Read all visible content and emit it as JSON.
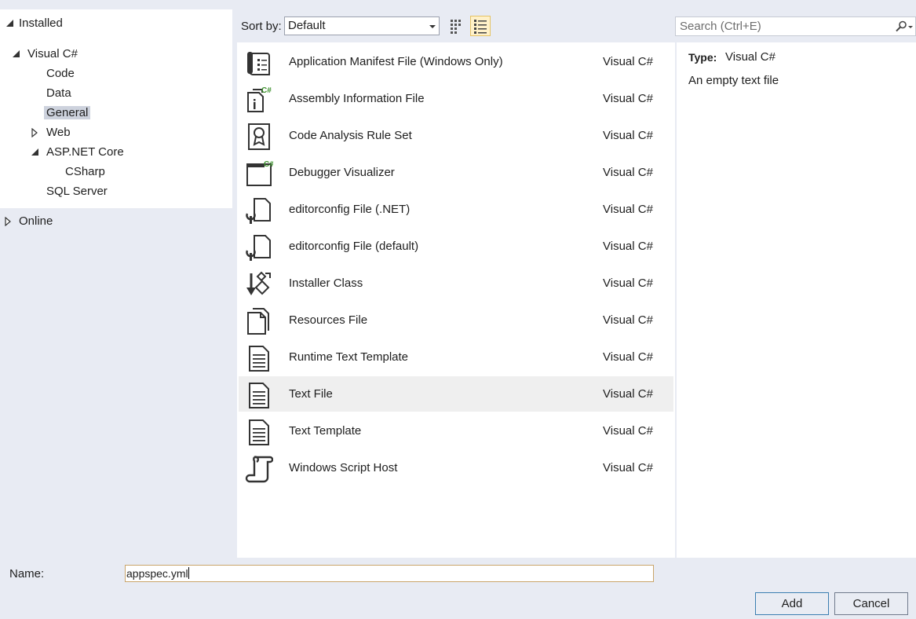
{
  "tree": {
    "installed": "Installed",
    "visual_csharp": "Visual C#",
    "code": "Code",
    "data": "Data",
    "general": "General",
    "web": "Web",
    "aspnet_core": "ASP.NET Core",
    "csharp": "CSharp",
    "sql_server": "SQL Server",
    "online": "Online"
  },
  "toolbar": {
    "sort_label": "Sort by:",
    "sort_value": "Default",
    "search_placeholder": "Search (Ctrl+E)"
  },
  "templates": [
    {
      "name": "Application Manifest File (Windows Only)",
      "lang": "Visual C#",
      "icon": "manifest-icon"
    },
    {
      "name": "Assembly Information File",
      "lang": "Visual C#",
      "icon": "assembly-info-icon"
    },
    {
      "name": "Code Analysis Rule Set",
      "lang": "Visual C#",
      "icon": "rule-set-icon"
    },
    {
      "name": "Debugger Visualizer",
      "lang": "Visual C#",
      "icon": "debugger-visualizer-icon"
    },
    {
      "name": "editorconfig File (.NET)",
      "lang": "Visual C#",
      "icon": "editorconfig-icon"
    },
    {
      "name": "editorconfig File (default)",
      "lang": "Visual C#",
      "icon": "editorconfig-icon"
    },
    {
      "name": "Installer Class",
      "lang": "Visual C#",
      "icon": "installer-icon"
    },
    {
      "name": "Resources File",
      "lang": "Visual C#",
      "icon": "resources-icon"
    },
    {
      "name": "Runtime Text Template",
      "lang": "Visual C#",
      "icon": "text-template-icon"
    },
    {
      "name": "Text File",
      "lang": "Visual C#",
      "icon": "text-file-icon",
      "selected": true
    },
    {
      "name": "Text Template",
      "lang": "Visual C#",
      "icon": "text-template-icon"
    },
    {
      "name": "Windows Script Host",
      "lang": "Visual C#",
      "icon": "script-host-icon"
    }
  ],
  "details": {
    "type_label": "Type:",
    "type_value": "Visual C#",
    "description": "An empty text file"
  },
  "bottom": {
    "name_label": "Name:",
    "name_value": "appspec.yml",
    "add_label": "Add",
    "cancel_label": "Cancel"
  },
  "colors": {
    "background": "#e8ebf3",
    "selected_row": "#efefef",
    "selected_tree": "#cdd2dd",
    "active_view": "#fff1c9",
    "csharp_green": "#3a8f2a"
  }
}
